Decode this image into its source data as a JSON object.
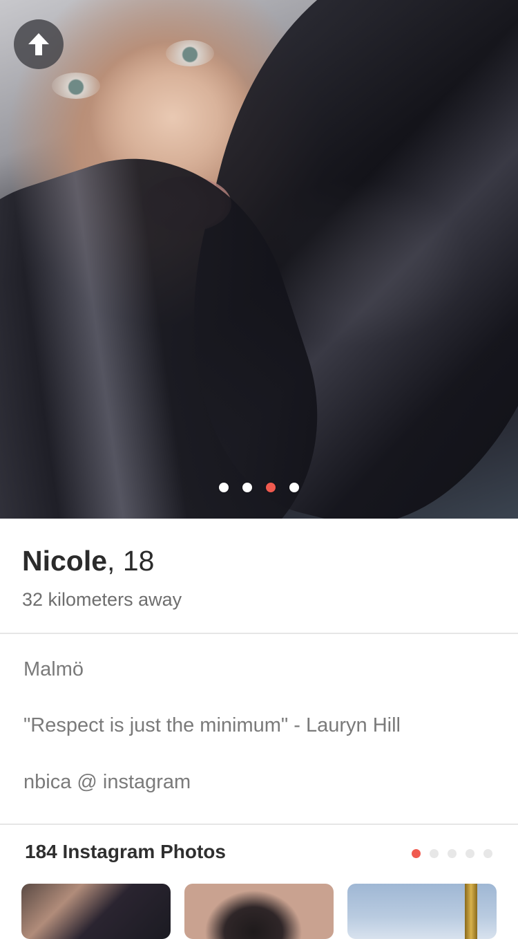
{
  "profile": {
    "name": "Nicole",
    "age_text": ", 18",
    "distance": "32 kilometers away",
    "photo_count": 4,
    "active_photo_index": 2
  },
  "bio": {
    "city": "Malmö",
    "quote": "\"Respect is just the minimum\" - Lauryn Hill",
    "instagram_handle": "nbica @ instagram"
  },
  "instagram": {
    "title": "184 Instagram Photos",
    "page_count": 5,
    "active_page_index": 0
  },
  "icons": {
    "back": "arrow-up-icon"
  },
  "colors": {
    "accent": "#f05a4f",
    "text_primary": "#2b2b2b",
    "text_secondary": "#7a7a7a",
    "divider": "#e6e6e6"
  }
}
